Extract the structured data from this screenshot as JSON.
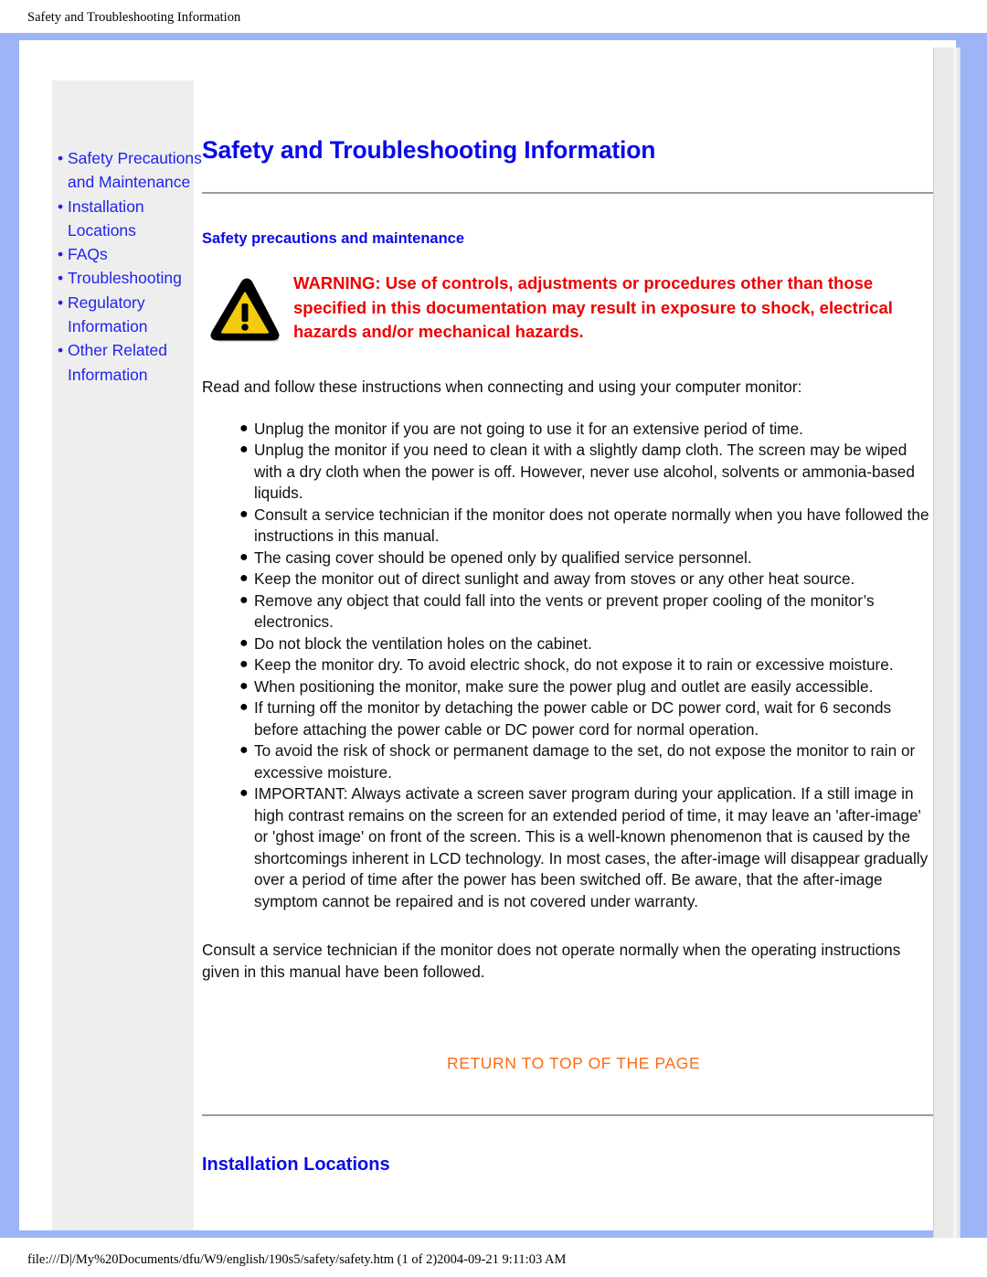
{
  "print_header": "Safety and Troubleshooting Information",
  "print_footer": "file:///D|/My%20Documents/dfu/W9/english/190s5/safety/safety.htm (1 of 2)2004-09-21 9:11:03 AM",
  "colors": {
    "frame_blue": "#9db5f7",
    "sidebar_gray": "#eeeeee",
    "link_blue": "#2222ee",
    "heading_blue": "#0a0ae8",
    "warning_red": "#ee0000",
    "return_orange": "#ff6a11",
    "warning_icon_fill": "#f2cb0d",
    "warning_icon_stroke": "#000000"
  },
  "sidebar": {
    "bullet": "•",
    "items": [
      {
        "label": "Safety Precautions and Maintenance"
      },
      {
        "label": "Installation Locations"
      },
      {
        "label": "FAQs"
      },
      {
        "label": "Troubleshooting"
      },
      {
        "label": "Regulatory Information"
      },
      {
        "label": "Other Related Information"
      }
    ]
  },
  "main": {
    "page_title": "Safety and Troubleshooting Information",
    "section_subtitle": "Safety precautions and maintenance",
    "warning_icon_name": "warning-triangle-icon",
    "warning_text": "WARNING: Use of controls, adjustments or procedures other than those specified in this documentation may result in exposure to shock, electrical hazards and/or mechanical hazards.",
    "intro_paragraph": "Read and follow these instructions when connecting and using your computer monitor:",
    "list_bullet": "●",
    "precautions": [
      "Unplug the monitor if you are not going to use it for an extensive period of time.",
      "Unplug the monitor if you need to clean it with a slightly damp cloth. The screen may be wiped with a dry cloth when the power is off. However, never use alcohol, solvents or ammonia-based liquids.",
      "Consult a service technician if the monitor does not operate normally when you have followed the instructions in this manual.",
      "The casing cover should be opened only by qualified service personnel.",
      "Keep the monitor out of direct sunlight and away from stoves or any other heat source.",
      "Remove any object that could fall into the vents or prevent proper cooling of the monitor’s electronics.",
      "Do not block the ventilation holes on the cabinet.",
      "Keep the monitor dry. To avoid electric shock, do not expose it to rain or excessive moisture.",
      "When positioning the monitor, make sure the power plug and outlet are easily accessible.",
      "If turning off the monitor by detaching the power cable or DC power cord, wait for 6 seconds before attaching the power cable or DC power cord for normal operation.",
      "To avoid the risk of shock or permanent damage to the set, do not expose the monitor to rain or excessive moisture.",
      "IMPORTANT: Always activate a screen saver program during your application. If a still image in high contrast remains on the screen for an extended period of time, it may leave an 'after-image' or 'ghost image' on front of the screen. This is a well-known phenomenon that is caused by the shortcomings inherent in LCD technology. In most cases, the after-image will disappear gradually over a period of time after the power has been switched off. Be aware, that the after-image symptom cannot be repaired and is not covered under warranty."
    ],
    "closing_paragraph": "Consult a service technician if the monitor does not operate normally when the operating instructions given in this manual have been followed.",
    "return_to_top": "RETURN TO TOP OF THE PAGE",
    "installation_heading": "Installation Locations"
  }
}
